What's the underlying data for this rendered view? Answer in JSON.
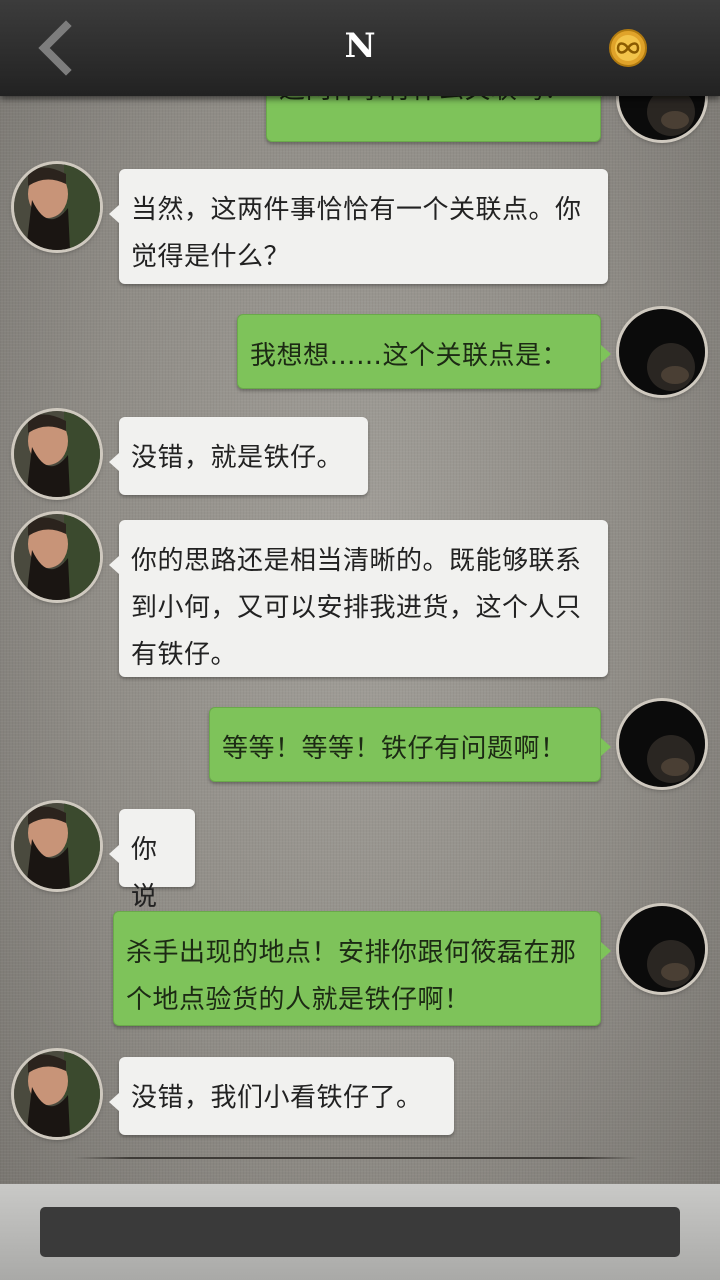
{
  "header": {
    "title": "N",
    "back_icon": "chevron-left-icon",
    "coin_icon": "infinity-coin-icon"
  },
  "conversation": {
    "messages": [
      {
        "from": "me",
        "text": "这两件事有什么关联吗？"
      },
      {
        "from": "them",
        "text": "当然，这两件事恰恰有一个关联点。你觉得是什么？"
      },
      {
        "from": "me",
        "text": "我想想……这个关联点是："
      },
      {
        "from": "them",
        "text": "没错，就是铁仔。"
      },
      {
        "from": "them",
        "text": "你的思路还是相当清晰的。既能够联系到小何，又可以安排我进货，这个人只有铁仔。"
      },
      {
        "from": "me",
        "text": "等等！等等！铁仔有问题啊！"
      },
      {
        "from": "them",
        "text": "你说"
      },
      {
        "from": "me",
        "text": "杀手出现的地点！安排你跟何筱磊在那个地点验货的人就是铁仔啊！"
      },
      {
        "from": "them",
        "text": "没错，我们小看铁仔了。"
      }
    ]
  },
  "composer": {
    "value": "",
    "placeholder": ""
  },
  "colors": {
    "bubble_incoming": "#f1f1ef",
    "bubble_outgoing": "#7ec35a",
    "header": "#2e2e2e"
  }
}
